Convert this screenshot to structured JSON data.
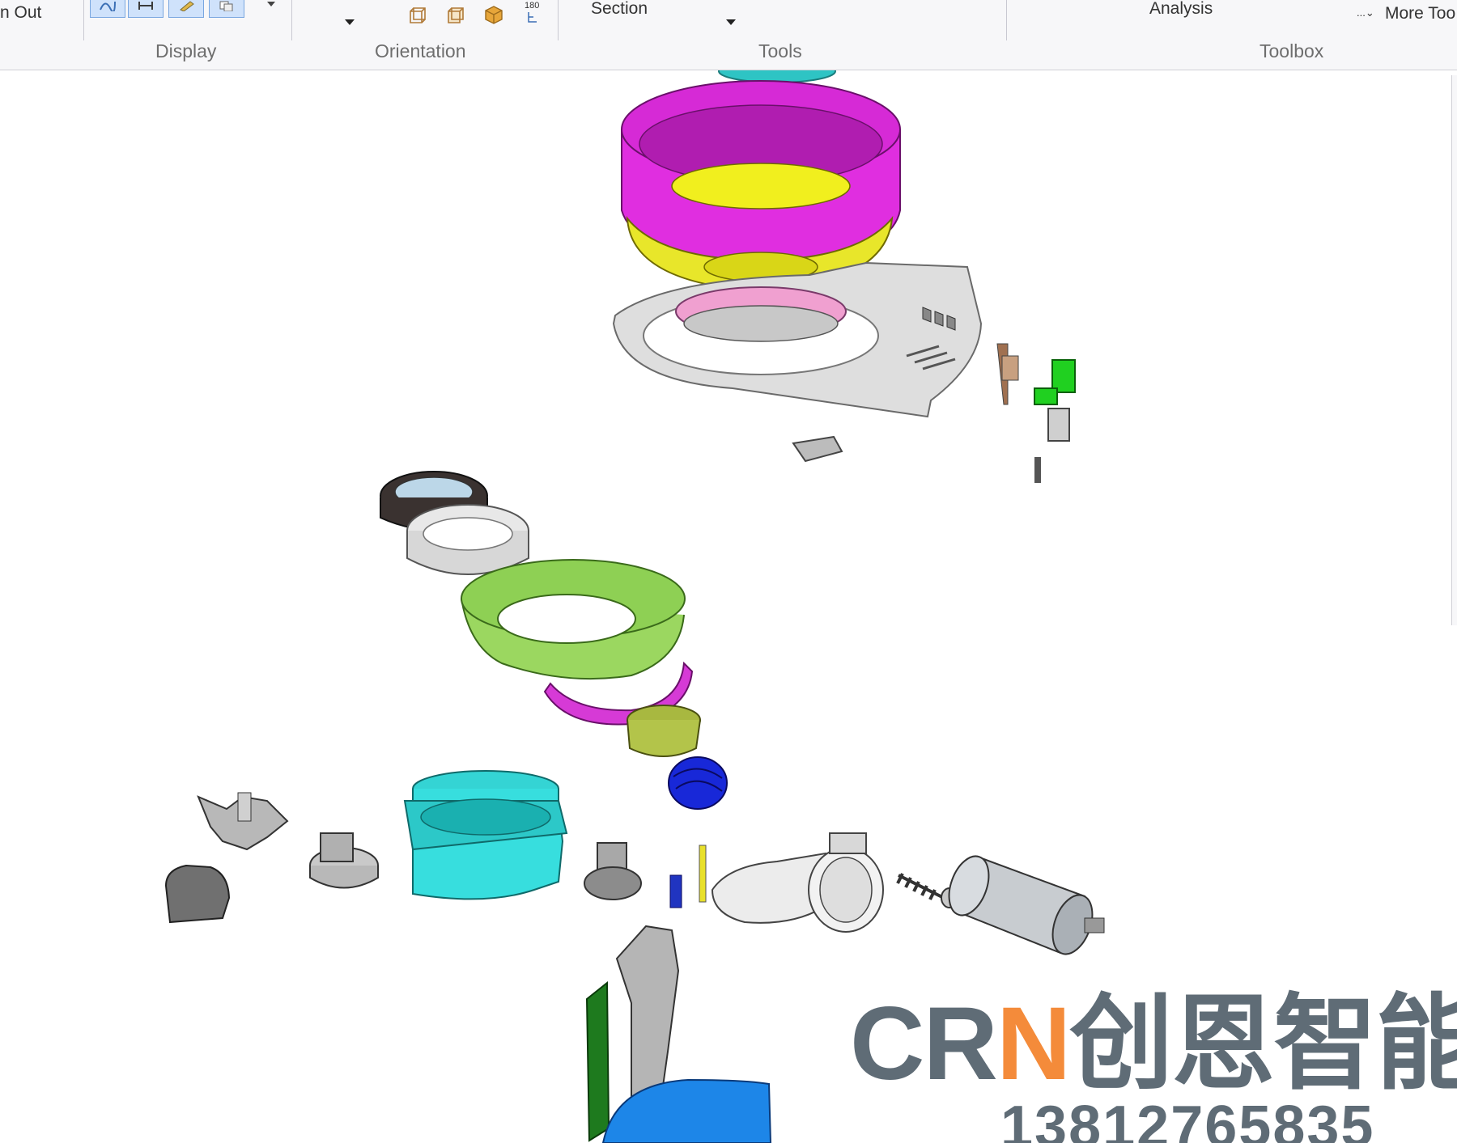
{
  "ribbon": {
    "zoom_out_label": "n Out",
    "groups": {
      "display": "Display",
      "orientation": "Orientation",
      "tools": "Tools",
      "toolbox": "Toolbox"
    },
    "orientation_rotate_label": "180",
    "tools_items": {
      "section": "Section"
    },
    "toolbox_items": {
      "analysis": "Analysis",
      "more_tools": "More Too",
      "more_tools_prefix": "...⌄"
    }
  },
  "watermark": {
    "brand_letters_gray": "CR",
    "brand_letter_orange": "N",
    "brand_chinese": "创恩智能",
    "phone": "13812765835",
    "colors": {
      "gray": "#5f6c76",
      "orange": "#f48b3a"
    }
  }
}
